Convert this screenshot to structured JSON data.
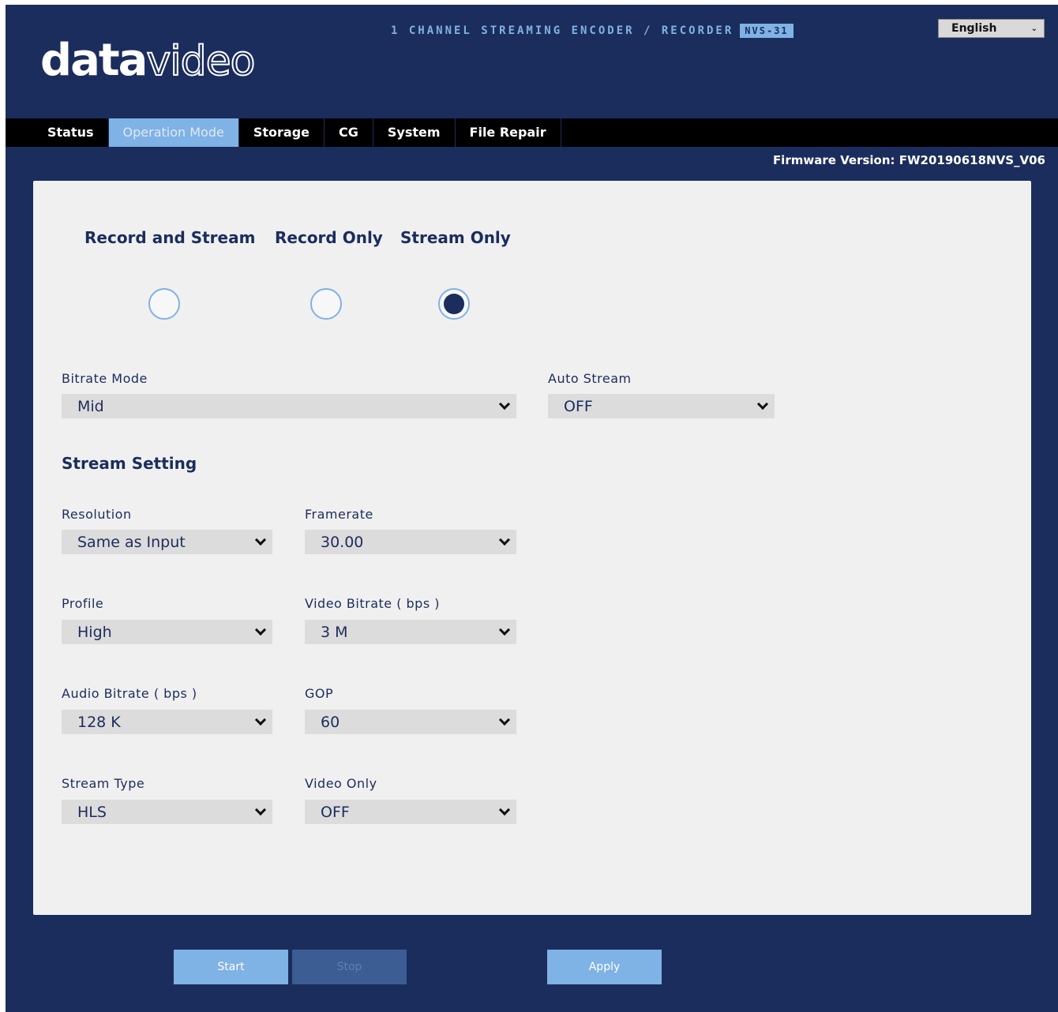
{
  "header": {
    "logo_bold": "data",
    "logo_thin": "video",
    "product_text": "1 CHANNEL STREAMING ENCODER / RECORDER",
    "model": "NVS-31",
    "language": "English"
  },
  "nav": {
    "tabs": [
      {
        "label": "Status"
      },
      {
        "label": "Operation Mode"
      },
      {
        "label": "Storage"
      },
      {
        "label": "CG"
      },
      {
        "label": "System"
      },
      {
        "label": "File Repair"
      }
    ],
    "active": "Operation Mode"
  },
  "firmware": "Firmware Version: FW20190618NVS_V06",
  "operation_modes": {
    "options": [
      {
        "label": "Record and Stream",
        "checked": false
      },
      {
        "label": "Record Only",
        "checked": false
      },
      {
        "label": "Stream Only",
        "checked": true
      }
    ]
  },
  "bitrate_mode": {
    "label": "Bitrate Mode",
    "value": "Mid"
  },
  "auto_stream": {
    "label": "Auto Stream",
    "value": "OFF"
  },
  "stream_setting": {
    "title": "Stream Setting",
    "resolution": {
      "label": "Resolution",
      "value": "Same as Input"
    },
    "framerate": {
      "label": "Framerate",
      "value": "30.00"
    },
    "profile": {
      "label": "Profile",
      "value": "High"
    },
    "video_bitrate": {
      "label": "Video Bitrate ( bps )",
      "value": "3 M"
    },
    "audio_bitrate": {
      "label": "Audio Bitrate ( bps )",
      "value": "128 K"
    },
    "gop": {
      "label": "GOP",
      "value": "60"
    },
    "stream_type": {
      "label": "Stream Type",
      "value": "HLS"
    },
    "video_only": {
      "label": "Video Only",
      "value": "OFF"
    }
  },
  "buttons": {
    "start": "Start",
    "stop": "Stop",
    "apply": "Apply"
  },
  "colors": {
    "background": "#1b2d5c",
    "accent": "#7fb2e5",
    "panel": "#f0f0f0"
  }
}
